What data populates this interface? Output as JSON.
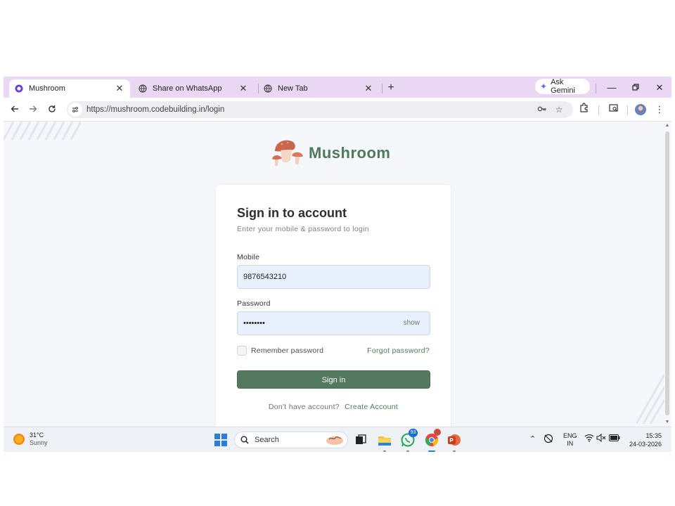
{
  "browser": {
    "tabs": [
      {
        "title": "Mushroom",
        "active": true,
        "icon": "mushroom-favicon"
      },
      {
        "title": "Share on WhatsApp",
        "active": false,
        "icon": "globe-icon"
      },
      {
        "title": "New Tab",
        "active": false,
        "icon": "globe-icon"
      }
    ],
    "new_tab_glyph": "+",
    "gemini_label": "Ask Gemini",
    "url": "https://mushroom.codebuilding.in/login"
  },
  "page": {
    "brand_name": "Mushroom",
    "card": {
      "title": "Sign in to account",
      "subtitle": "Enter your mobile & password to login",
      "mobile_label": "Mobile",
      "mobile_value": "9876543210",
      "password_label": "Password",
      "password_value": "••••••••",
      "show_label": "show",
      "remember_label": "Remember password",
      "forgot_label": "Forgot password?",
      "signin_label": "Sign in",
      "signup_question": "Don't have account?",
      "signup_link": "Create Account"
    },
    "colors": {
      "accent": "#537a5e",
      "brand": "#4e7a5c",
      "input_bg": "#e8f0fe"
    }
  },
  "taskbar": {
    "weather_temp": "31°C",
    "weather_desc": "Sunny",
    "search_label": "Search",
    "whatsapp_badge": "93",
    "lang_top": "ENG",
    "lang_bottom": "IN",
    "time": "15:35",
    "date": "24-03-2026"
  }
}
